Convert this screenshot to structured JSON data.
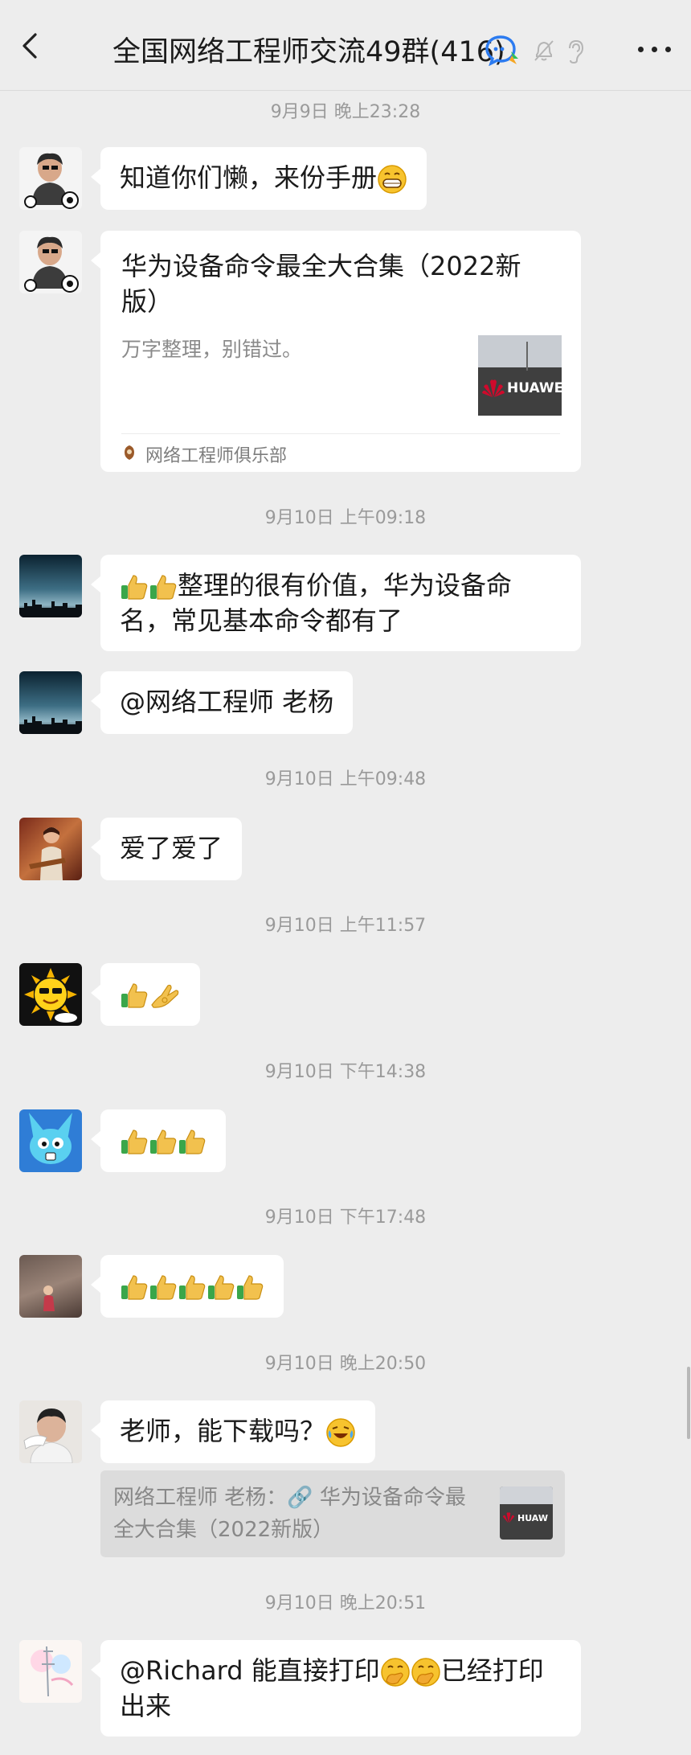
{
  "header": {
    "title": "全国网络工程师交流49群(416)"
  },
  "messages": {
    "t1": "9月9日 晚上23:28",
    "m1": "知道你们懒，来份手册",
    "card": {
      "title": "华为设备命令最全大合集（2022新版）",
      "desc": "万字整理，别错过。",
      "thumb_text": "HUAWE",
      "source": "网络工程师俱乐部"
    },
    "t2": "9月10日 上午09:18",
    "m2": "整理的很有价值，华为设备命名，常见基本命令都有了",
    "m3": "@网络工程师 老杨",
    "t3": "9月10日 上午09:48",
    "m4": "爱了爱了",
    "t4": "9月10日 上午11:57",
    "t5": "9月10日 下午14:38",
    "t6": "9月10日 下午17:48",
    "t7": "9月10日 晚上20:50",
    "m8": "老师，能下载吗？",
    "quote": {
      "text": "网络工程师 老杨：🔗 华为设备命令最全大合集（2022新版）",
      "thumb_text": "HUAW"
    },
    "t8": "9月10日 晚上20:51",
    "m9a": "@Richard  能直接打印",
    "m9b": "已经打印出来"
  },
  "colors": {
    "background": "#ededed",
    "bubble": "#ffffff",
    "huawei_red": "#cf0a2c",
    "thumb_up": "#f2c14e"
  }
}
